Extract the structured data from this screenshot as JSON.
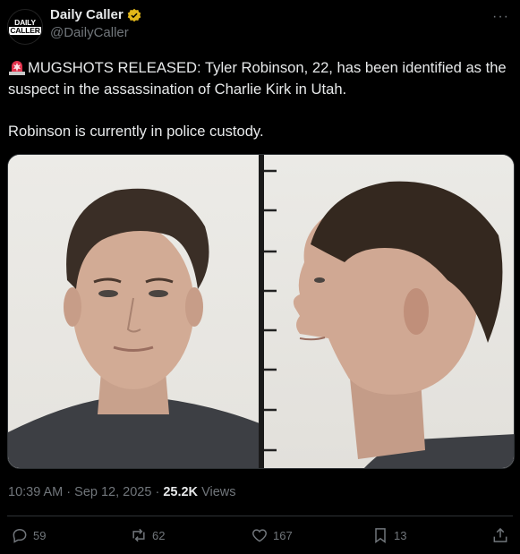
{
  "post": {
    "display_name": "Daily Caller",
    "handle": "@DailyCaller",
    "avatar_text_line1": "DAILY",
    "avatar_text_line2": "CALLER",
    "more_label": "···",
    "text_line1": "MUGSHOTS RELEASED: Tyler Robinson, 22, has been identified as the suspect in the assassination of Charlie Kirk in Utah.",
    "text_line2": "Robinson is currently in police custody.",
    "time": "10:39 AM",
    "date": "Sep 12, 2025",
    "views_count": "25.2K",
    "views_label": "Views"
  },
  "actions": {
    "replies": "59",
    "reposts": "62",
    "likes": "167",
    "bookmarks": "13"
  },
  "icons": {
    "siren": "siren-emoji-icon",
    "verified": "verified-badge-icon",
    "reply": "reply-icon",
    "repost": "repost-icon",
    "like": "heart-icon",
    "bookmark": "bookmark-icon",
    "share": "share-icon"
  },
  "colors": {
    "background": "#000000",
    "text": "#e7e9ea",
    "muted": "#71767b",
    "verified": "#e2b719"
  }
}
